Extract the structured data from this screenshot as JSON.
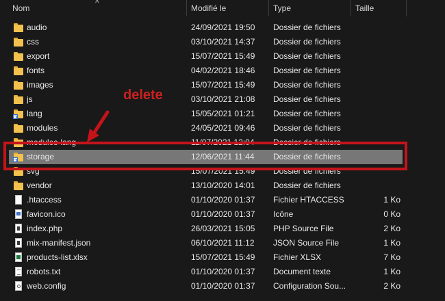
{
  "header": {
    "columns": {
      "name": "Nom",
      "date": "Modifié le",
      "type": "Type",
      "size": "Taille"
    }
  },
  "accent": {
    "annotation": "#c4141a",
    "folder": "#f2c14e",
    "selection": "#777777"
  },
  "annotation": {
    "label": "delete"
  },
  "files": [
    {
      "name": "audio",
      "date": "24/09/2021 19:50",
      "type": "Dossier de fichiers",
      "size": "",
      "icon": "folder-icon"
    },
    {
      "name": "css",
      "date": "03/10/2021 14:37",
      "type": "Dossier de fichiers",
      "size": "",
      "icon": "folder-icon"
    },
    {
      "name": "export",
      "date": "15/07/2021 15:49",
      "type": "Dossier de fichiers",
      "size": "",
      "icon": "folder-icon"
    },
    {
      "name": "fonts",
      "date": "04/02/2021 18:46",
      "type": "Dossier de fichiers",
      "size": "",
      "icon": "folder-icon"
    },
    {
      "name": "images",
      "date": "15/07/2021 15:49",
      "type": "Dossier de fichiers",
      "size": "",
      "icon": "folder-icon"
    },
    {
      "name": "js",
      "date": "03/10/2021 21:08",
      "type": "Dossier de fichiers",
      "size": "",
      "icon": "folder-icon"
    },
    {
      "name": "lang",
      "date": "15/05/2021 01:21",
      "type": "Dossier de fichiers",
      "size": "",
      "icon": "folder-shortcut-icon"
    },
    {
      "name": "modules",
      "date": "24/05/2021 09:46",
      "type": "Dossier de fichiers",
      "size": "",
      "icon": "folder-icon"
    },
    {
      "name": "modules-lang",
      "date": "11/07/2021 12:04",
      "type": "Dossier de fichiers",
      "size": "",
      "icon": "folder-icon"
    },
    {
      "name": "storage",
      "date": "12/06/2021 11:44",
      "type": "Dossier de fichiers",
      "size": "",
      "icon": "folder-shortcut-icon",
      "selected": true
    },
    {
      "name": "svg",
      "date": "15/07/2021 15:49",
      "type": "Dossier de fichiers",
      "size": "",
      "icon": "folder-icon"
    },
    {
      "name": "vendor",
      "date": "13/10/2020 14:01",
      "type": "Dossier de fichiers",
      "size": "",
      "icon": "folder-icon"
    },
    {
      "name": ".htaccess",
      "date": "01/10/2020 01:37",
      "type": "Fichier HTACCESS",
      "size": "1 Ko",
      "icon": "file-icon"
    },
    {
      "name": "favicon.ico",
      "date": "01/10/2020 01:37",
      "type": "Icône",
      "size": "0 Ko",
      "icon": "image-file-icon"
    },
    {
      "name": "index.php",
      "date": "26/03/2021 15:05",
      "type": "PHP Source File",
      "size": "2 Ko",
      "icon": "php-file-icon"
    },
    {
      "name": "mix-manifest.json",
      "date": "06/10/2021 11:12",
      "type": "JSON Source File",
      "size": "1 Ko",
      "icon": "json-file-icon"
    },
    {
      "name": "products-list.xlsx",
      "date": "15/07/2021 15:49",
      "type": "Fichier XLSX",
      "size": "7 Ko",
      "icon": "excel-file-icon"
    },
    {
      "name": "robots.txt",
      "date": "01/10/2020 01:37",
      "type": "Document texte",
      "size": "1 Ko",
      "icon": "text-file-icon"
    },
    {
      "name": "web.config",
      "date": "01/10/2020 01:37",
      "type": "Configuration Sou...",
      "size": "2 Ko",
      "icon": "config-file-icon"
    }
  ]
}
